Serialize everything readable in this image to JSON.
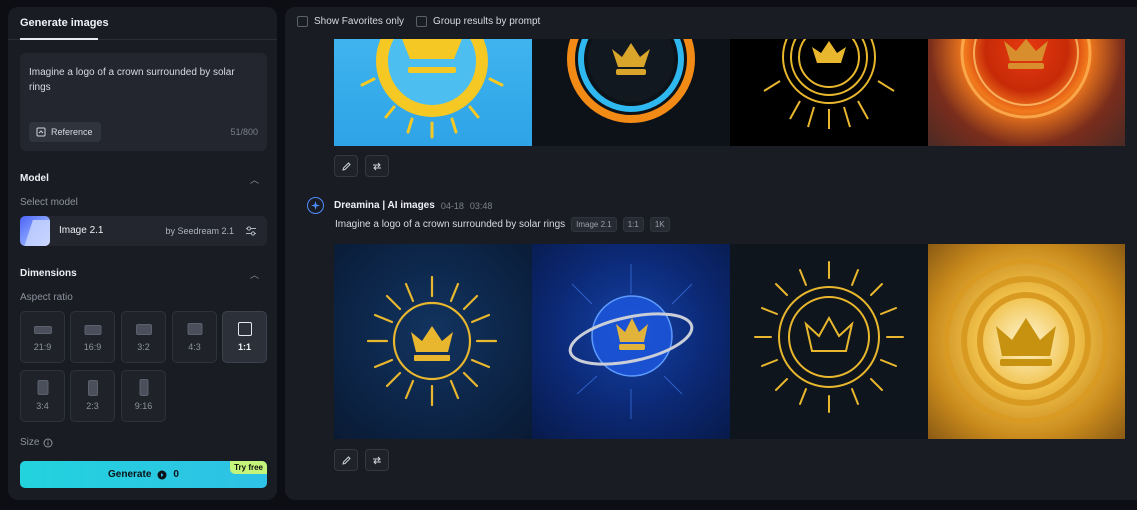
{
  "left_panel": {
    "tab_label": "Generate images",
    "prompt_text": "Imagine a logo of a crown surrounded by solar rings",
    "reference_label": "Reference",
    "char_count": "51/800",
    "model_section": {
      "title": "Model",
      "select_label": "Select model",
      "model_name": "Image 2.1",
      "model_by": "by Seedream 2.1"
    },
    "dimensions_section": {
      "title": "Dimensions",
      "aspect_label": "Aspect ratio",
      "ratios": [
        "21:9",
        "16:9",
        "3:2",
        "4:3",
        "1:1",
        "3:4",
        "2:3",
        "9:16"
      ],
      "selected_ratio": "1:1",
      "size_label": "Size"
    },
    "generate_label": "Generate",
    "generate_cost": "0",
    "try_free_label": "Try free"
  },
  "results": {
    "filter_favorites": "Show Favorites only",
    "filter_group": "Group results by prompt",
    "generation": {
      "source_name": "Dreamina | AI images",
      "date": "04-18",
      "time": "03:48",
      "prompt": "Imagine a logo of a crown surrounded by solar rings",
      "tags": [
        "Image 2.1",
        "1:1",
        "1K"
      ]
    }
  }
}
